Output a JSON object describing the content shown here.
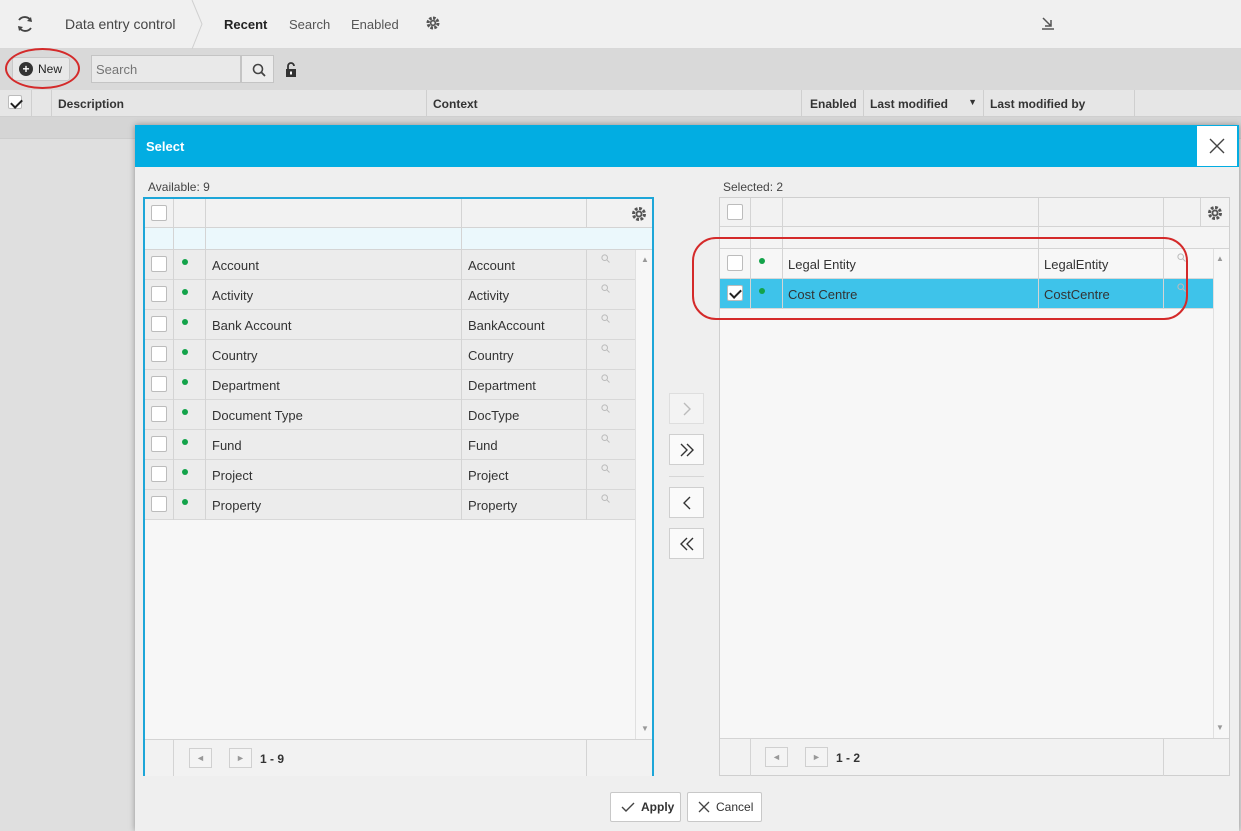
{
  "topbar": {
    "app_title": "Data entry control",
    "tabs": [
      "Recent",
      "Search",
      "Enabled"
    ],
    "active_tab": "Recent"
  },
  "toolbar": {
    "new_label": "New",
    "search_placeholder": "Search"
  },
  "grid": {
    "columns": [
      "Description",
      "Context",
      "Enabled",
      "Last modified",
      "Last modified by"
    ]
  },
  "modal": {
    "title": "Select",
    "available_label": "Available: 9",
    "selected_label": "Selected: 2",
    "available_items": [
      {
        "description": "Account",
        "code": "Account"
      },
      {
        "description": "Activity",
        "code": "Activity"
      },
      {
        "description": "Bank Account",
        "code": "BankAccount"
      },
      {
        "description": "Country",
        "code": "Country"
      },
      {
        "description": "Department",
        "code": "Department"
      },
      {
        "description": "Document Type",
        "code": "DocType"
      },
      {
        "description": "Fund",
        "code": "Fund"
      },
      {
        "description": "Project",
        "code": "Project"
      },
      {
        "description": "Property",
        "code": "Property"
      }
    ],
    "selected_items": [
      {
        "description": "Legal Entity",
        "code": "LegalEntity",
        "checked": false
      },
      {
        "description": "Cost Centre",
        "code": "CostCentre",
        "checked": true
      }
    ],
    "available_pager": "1 - 9",
    "selected_pager": "1 - 2",
    "apply_label": "Apply",
    "cancel_label": "Cancel"
  },
  "colors": {
    "header_blue": "#02ade2",
    "selected_row": "#3ec3ea",
    "status_dot": "#13a34a",
    "annotation_red": "#d42a2a"
  }
}
